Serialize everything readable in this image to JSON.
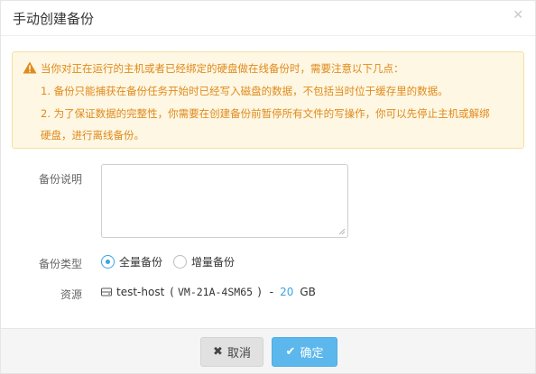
{
  "dialog": {
    "title": "手动创建备份",
    "close_icon": "close-icon"
  },
  "alert": {
    "icon": "warning-icon",
    "color": "#e08a1c",
    "line1": "当你对正在运行的主机或者已经绑定的硬盘做在线备份时，需要注意以下几点：",
    "line2": "1. 备份只能捕获在备份任务开始时已经写入磁盘的数据，不包括当时位于缓存里的数据。",
    "line3": "2. 为了保证数据的完整性，你需要在创建备份前暂停所有文件的写操作，你可以先停止主机或解绑",
    "line4": "硬盘，进行离线备份。"
  },
  "form": {
    "description_label": "备份说明",
    "description_value": "",
    "type_label": "备份类型",
    "type_options": [
      {
        "label": "全量备份",
        "checked": true
      },
      {
        "label": "增量备份",
        "checked": false
      }
    ],
    "resource_label": "资源",
    "resource": {
      "icon": "host-icon",
      "name": "test-host",
      "open_paren": "(",
      "id": "VM-21A-4SM65",
      "close_paren": ")",
      "sep": "-",
      "size": "20",
      "unit": "GB"
    }
  },
  "footer": {
    "cancel_label": "取消",
    "ok_label": "确定",
    "accent": "#5cb7ec"
  }
}
